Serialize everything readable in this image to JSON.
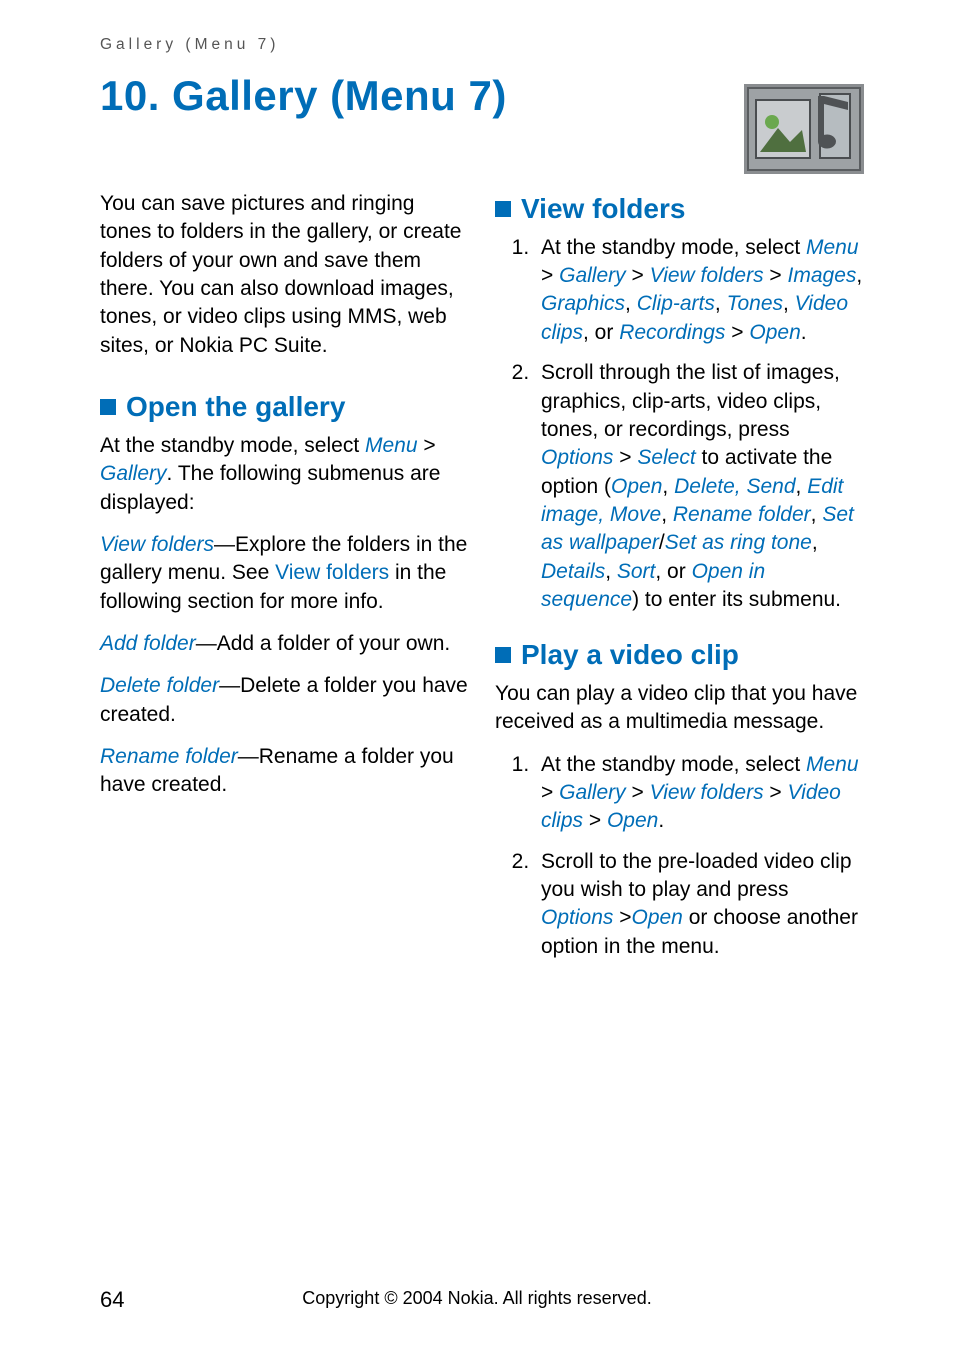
{
  "header": {
    "label": "Gallery (Menu 7)"
  },
  "chapter": {
    "title": "10. Gallery (Menu 7)"
  },
  "icon": {
    "name": "gallery-icon"
  },
  "intro": "You can save pictures and ringing tones to folders in the gallery, or create folders of your own and save them there. You can also download images, tones, or video clips using MMS, web sites, or Nokia PC Suite.",
  "sections": {
    "open_gallery": {
      "title": "Open the gallery",
      "p1a": "At the standby mode, select ",
      "ui_menu": "Menu",
      "gt1": " > ",
      "ui_gallery": "Gallery",
      "p1b": ". The following submenus are displayed:",
      "vf_label": "View folders",
      "vf_dashtext": "—Explore the folders in the gallery menu. See ",
      "vf_link": "View folders",
      "vf_tail": " in the following section for more info.",
      "af_label": "Add folder",
      "af_text": "—Add a folder of your own.",
      "df_label": "Delete folder",
      "df_text": "—Delete a folder you have created.",
      "rf_label": "Rename folder",
      "rf_text": "—Rename a folder you have created."
    },
    "view_folders": {
      "title": "View folders",
      "step1_a": "At the standby mode, select ",
      "ui_menu": "Menu",
      "gt1": " > ",
      "ui_gallery": "Gallery",
      "gt2": " > ",
      "ui_vf": "View folders",
      "gt3": " > ",
      "ui_images": "Images",
      "c1": ", ",
      "ui_graphics": "Graphics",
      "c2": ", ",
      "ui_cliparts": "Clip-arts",
      "c3": ", ",
      "ui_tones": "Tones",
      "c4": ", ",
      "ui_videoclips": "Video clips",
      "or": ", or ",
      "ui_recordings": "Recordings",
      "gt4": " > ",
      "ui_open": "Open",
      "dot": ".",
      "step2_a": "Scroll through the list of images, graphics, clip-arts, video clips, tones, or recordings, press ",
      "ui_options": "Options",
      "gt5": " > ",
      "ui_select": "Select",
      "step2_b": " to activate the option (",
      "ui_open2": "Open",
      "c5": ", ",
      "ui_delete_send": "Delete, Send",
      "c6": ", ",
      "ui_edit_image_move": "Edit image, Move",
      "c7": ", ",
      "ui_rename_folder": "Rename folder",
      "c8": ", ",
      "ui_set_wallpaper": "Set as wallpaper",
      "slash": "/",
      "ui_set_ring": "Set as ring tone",
      "c9": ", ",
      "ui_details": "Details",
      "c10": ", ",
      "ui_sort": "Sort",
      "or2": ", or ",
      "ui_open_seq": "Open in sequence",
      "step2_c": ") to enter its submenu."
    },
    "play_video": {
      "title": "Play a video clip",
      "intro": "You can play a video clip that you have received as a multimedia message.",
      "step1_a": "At the standby mode, select ",
      "ui_menu": "Menu",
      "gt1": " > ",
      "ui_gallery": "Gallery",
      "gt2": " > ",
      "ui_vf": "View folders",
      "gt3": " > ",
      "ui_videoclips": "Video clips",
      "gt4": " > ",
      "ui_open": "Open",
      "dot": ".",
      "step2_a": "Scroll to the pre-loaded video clip you wish to play and press ",
      "ui_options": "Options",
      "gt5": " >",
      "ui_open2": "Open",
      "step2_b": " or choose another option in the menu."
    }
  },
  "footer": {
    "page": "64",
    "copyright": "Copyright © 2004 Nokia. All rights reserved."
  }
}
